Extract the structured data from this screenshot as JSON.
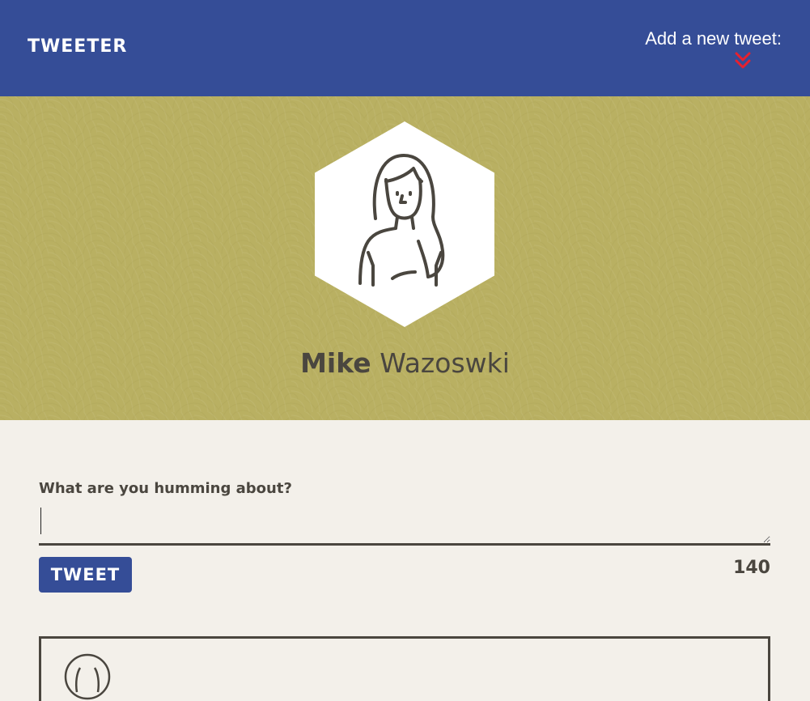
{
  "nav": {
    "brand": "TWEETER",
    "compose_toggle_label": "Add a new tweet:"
  },
  "profile": {
    "first_name": "Mike",
    "last_name": "Wazoswki"
  },
  "composer": {
    "label": "What are you humming about?",
    "textarea_value": "",
    "submit_label": "TWEET",
    "char_count": "140"
  },
  "colors": {
    "nav_bg": "#354d97",
    "header_bg": "#b9b062",
    "page_bg": "#f3f0ea",
    "accent_red": "#e8202e",
    "text_dark": "#4a463f"
  },
  "icons": {
    "chevron": "double-chevron-down-icon",
    "avatar": "user-avatar-icon"
  }
}
